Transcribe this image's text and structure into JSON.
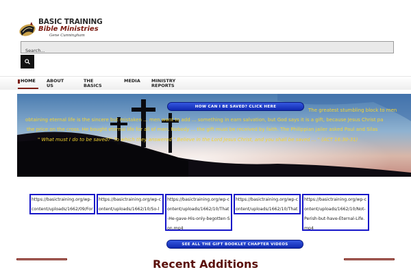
{
  "header": {
    "logo_line1": "BASIC TRAINING",
    "logo_line2": "Bible Ministries",
    "logo_line3": "Gene Cunningham",
    "logo_icon": "bible-icon"
  },
  "search": {
    "placeholder": "Search...",
    "button_icon": "search-icon"
  },
  "nav": {
    "items": [
      {
        "label": "HOME"
      },
      {
        "label": "ABOUT US"
      },
      {
        "label": "THE BASICS"
      },
      {
        "label": "MEDIA"
      },
      {
        "label": "MINISTRY REPORTS"
      }
    ]
  },
  "hero": {
    "cta_label": "HOW CAN I BE SAVED? CLICK HERE",
    "text_line1": "The greatest stumbling block to men",
    "text_line2": "obtaining eternal life is the sincere but mistaken ... men want to add ... something in earn salvation, but God says it is a gift, because Jesus Christ pa",
    "text_line3": "the price on the cross. He bought eternal life for all of men. Nobody ... the gift must be received by faith. The Philippian jailer asked Paul and Silas",
    "text_line4": "\" What must I do to be saved?\" To which they answered \" Believe in the Lord Jesus Christ, and you shall be saved ... \"  (ACT 16:30-31)"
  },
  "videos": [
    {
      "url": "https://basictraining.org/wp-content/uploads/1662/09/Forgiveness.mp4"
    },
    {
      "url": "https://basictraining.org/wp-content/uploads/1662/10/So-loved-the-World.mp4"
    },
    {
      "url": "https://basictraining.org/wp-content/uploads/1662/10/That-He-gave-His-only-begotten-Son.mp4"
    },
    {
      "url": "https://basictraining.org/wp-content/uploads/1662/10/That-Whoever-Believes-in-Him.mp4"
    },
    {
      "url": "https://basictraining.org/wp-content/uploads/1662/10/Not-Perish-but-have-Eternal-Life.mp4"
    }
  ],
  "videos_cta_label": "SEE ALL THE GIFT BOOKLET CHAPTER VIDEOS",
  "recent": {
    "title": "Recent Additions"
  },
  "colors": {
    "brand": "#7a1a10",
    "link_border": "#1515c8",
    "pill": "#1a34c8",
    "hero_text": "#f5d430"
  }
}
